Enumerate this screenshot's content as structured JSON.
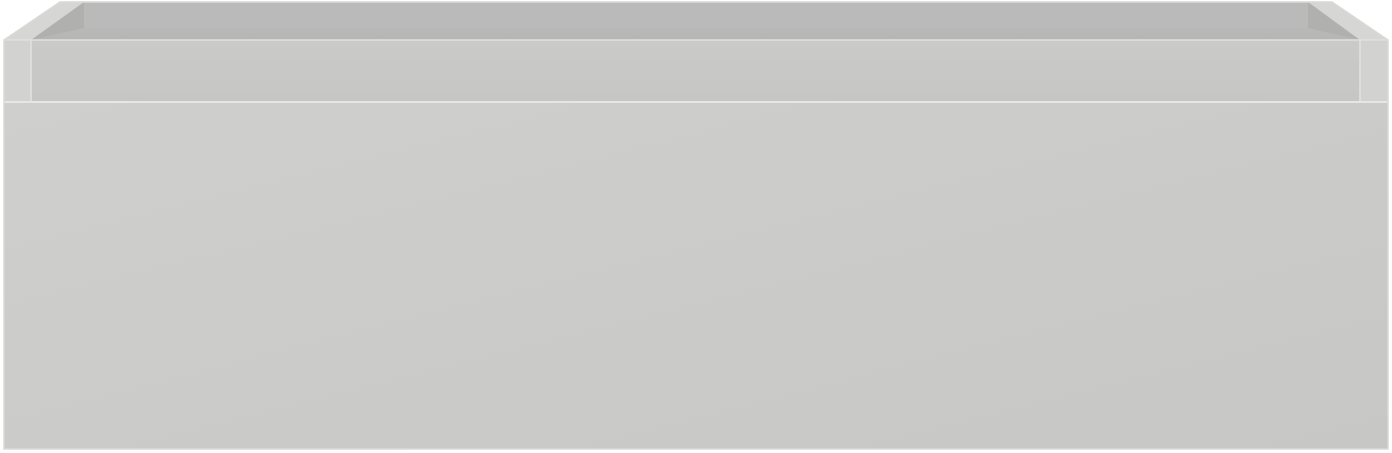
{
  "object": {
    "name": "drawer-box",
    "colors": {
      "background": "#ffffff",
      "front_panel": "#cbcbc9",
      "top_edge": "#c4c4c2",
      "inner_back_wall": "#b9b9b8",
      "inner_side_walls": "#b3b3b2",
      "inner_floor": "#c6c6c4",
      "outline": "#d9d9d7",
      "highlight": "#e6e6e4"
    }
  }
}
